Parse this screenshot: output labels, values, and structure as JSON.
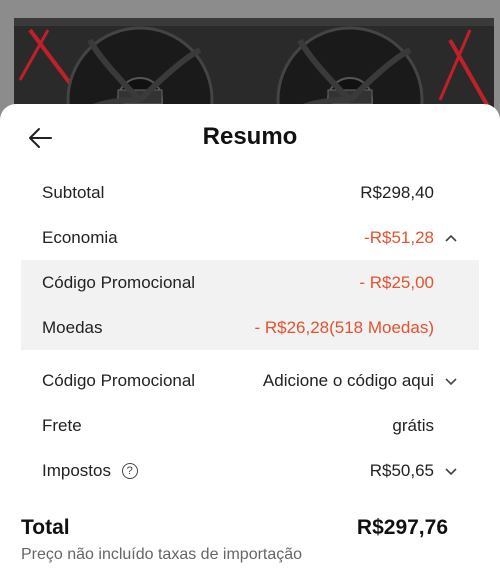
{
  "header": {
    "title": "Resumo",
    "back_icon": "arrow-left-icon"
  },
  "summary": {
    "subtotal": {
      "label": "Subtotal",
      "value": "R$298,40"
    },
    "economia": {
      "label": "Economia",
      "value": "-R$51,28",
      "expanded": true
    },
    "promo_discount": {
      "label": "Código Promocional",
      "value": "- R$25,00"
    },
    "coins": {
      "label": "Moedas",
      "value": "- R$26,28(518 Moedas)"
    },
    "promo_code": {
      "label": "Código Promocional",
      "value": "Adicione o código aqui"
    },
    "shipping": {
      "label": "Frete",
      "value": "grátis"
    },
    "taxes": {
      "label": "Impostos",
      "value": "R$50,65",
      "help_icon": "question-circle-icon"
    }
  },
  "total": {
    "label": "Total",
    "value": "R$297,76",
    "note": "Preço não incluído taxas de importação"
  },
  "colors": {
    "accent_red": "#e3532f",
    "sheet_bg": "#ffffff",
    "highlight_bg": "#f2f2f2"
  }
}
